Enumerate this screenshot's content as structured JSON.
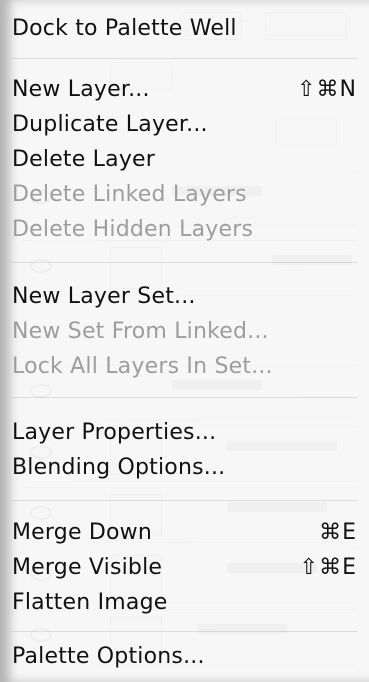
{
  "menu": {
    "items": [
      {
        "label": "Dock to Palette Well",
        "shortcut": "",
        "enabled": true
      },
      {
        "label": "New Layer...",
        "shortcut": "⇧⌘N",
        "enabled": true
      },
      {
        "label": "Duplicate Layer...",
        "shortcut": "",
        "enabled": true
      },
      {
        "label": "Delete Layer",
        "shortcut": "",
        "enabled": true
      },
      {
        "label": "Delete Linked Layers",
        "shortcut": "",
        "enabled": false
      },
      {
        "label": "Delete Hidden Layers",
        "shortcut": "",
        "enabled": false
      },
      {
        "label": "New Layer Set...",
        "shortcut": "",
        "enabled": true
      },
      {
        "label": "New Set From Linked...",
        "shortcut": "",
        "enabled": false
      },
      {
        "label": "Lock All Layers In Set...",
        "shortcut": "",
        "enabled": false
      },
      {
        "label": "Layer Properties...",
        "shortcut": "",
        "enabled": true
      },
      {
        "label": "Blending Options...",
        "shortcut": "",
        "enabled": true
      },
      {
        "label": "Merge Down",
        "shortcut": "⌘E",
        "enabled": true
      },
      {
        "label": "Merge Visible",
        "shortcut": "⇧⌘E",
        "enabled": true
      },
      {
        "label": "Flatten Image",
        "shortcut": "",
        "enabled": true
      },
      {
        "label": "Palette Options...",
        "shortcut": "",
        "enabled": true
      }
    ]
  },
  "theme": {
    "enabled_text": "#111111",
    "disabled_text": "#9d9d9d",
    "menu_background": "#f8f8f8"
  }
}
